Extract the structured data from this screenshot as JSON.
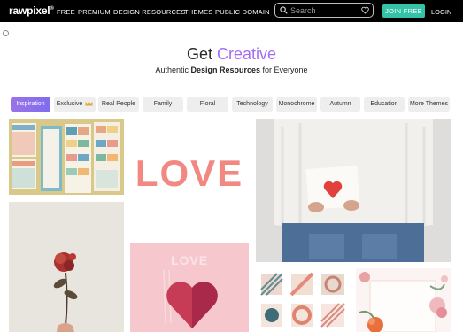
{
  "nav": {
    "logo": "rawpixel",
    "logo_mark": "®",
    "links": [
      "FREE",
      "PREMIUM",
      "DESIGN RESOURCES",
      "THEMES",
      "PUBLIC DOMAIN"
    ],
    "search_placeholder": "Search",
    "join_label": "JOIN FREE",
    "login_label": "LOGIN"
  },
  "hero": {
    "title_plain": "Get ",
    "title_accent": "Creative",
    "subtitle_pre": "Authentic ",
    "subtitle_bold": "Design Resources",
    "subtitle_post": " for Everyone"
  },
  "filters": [
    "Inspiration",
    "Exclusive",
    "Real People",
    "Family",
    "Floral",
    "Technology",
    "Monochrome",
    "Autumn",
    "Education",
    "More Themes"
  ],
  "tiles": {
    "love_text": "LOVE",
    "love_card_text": "LOVE"
  },
  "colors": {
    "accent": "#a36df3",
    "join": "#35c3a7",
    "nav_bg": "#000000"
  }
}
